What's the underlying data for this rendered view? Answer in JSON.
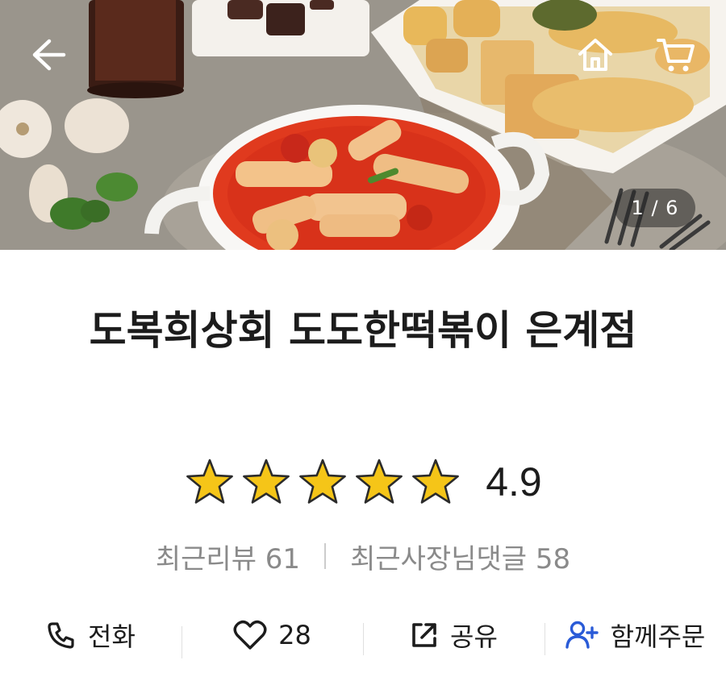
{
  "header": {
    "back_icon": "back-arrow-icon",
    "home_icon": "home-icon",
    "cart_icon": "cart-icon"
  },
  "gallery": {
    "counter": "1 / 6",
    "current": 1,
    "total": 6
  },
  "store": {
    "name": "도복희상회 도도한떡볶이 은계점",
    "rating": "4.9",
    "stars_filled": 5,
    "star_color": "#f5c518"
  },
  "counts": {
    "reviews_label": "최근리뷰 61",
    "owner_replies_label": "최근사장님댓글 58"
  },
  "actions": {
    "call_label": "전화",
    "like_count": "28",
    "share_label": "공유",
    "group_order_label": "함께주문",
    "group_icon_color": "#2a5bd7"
  }
}
